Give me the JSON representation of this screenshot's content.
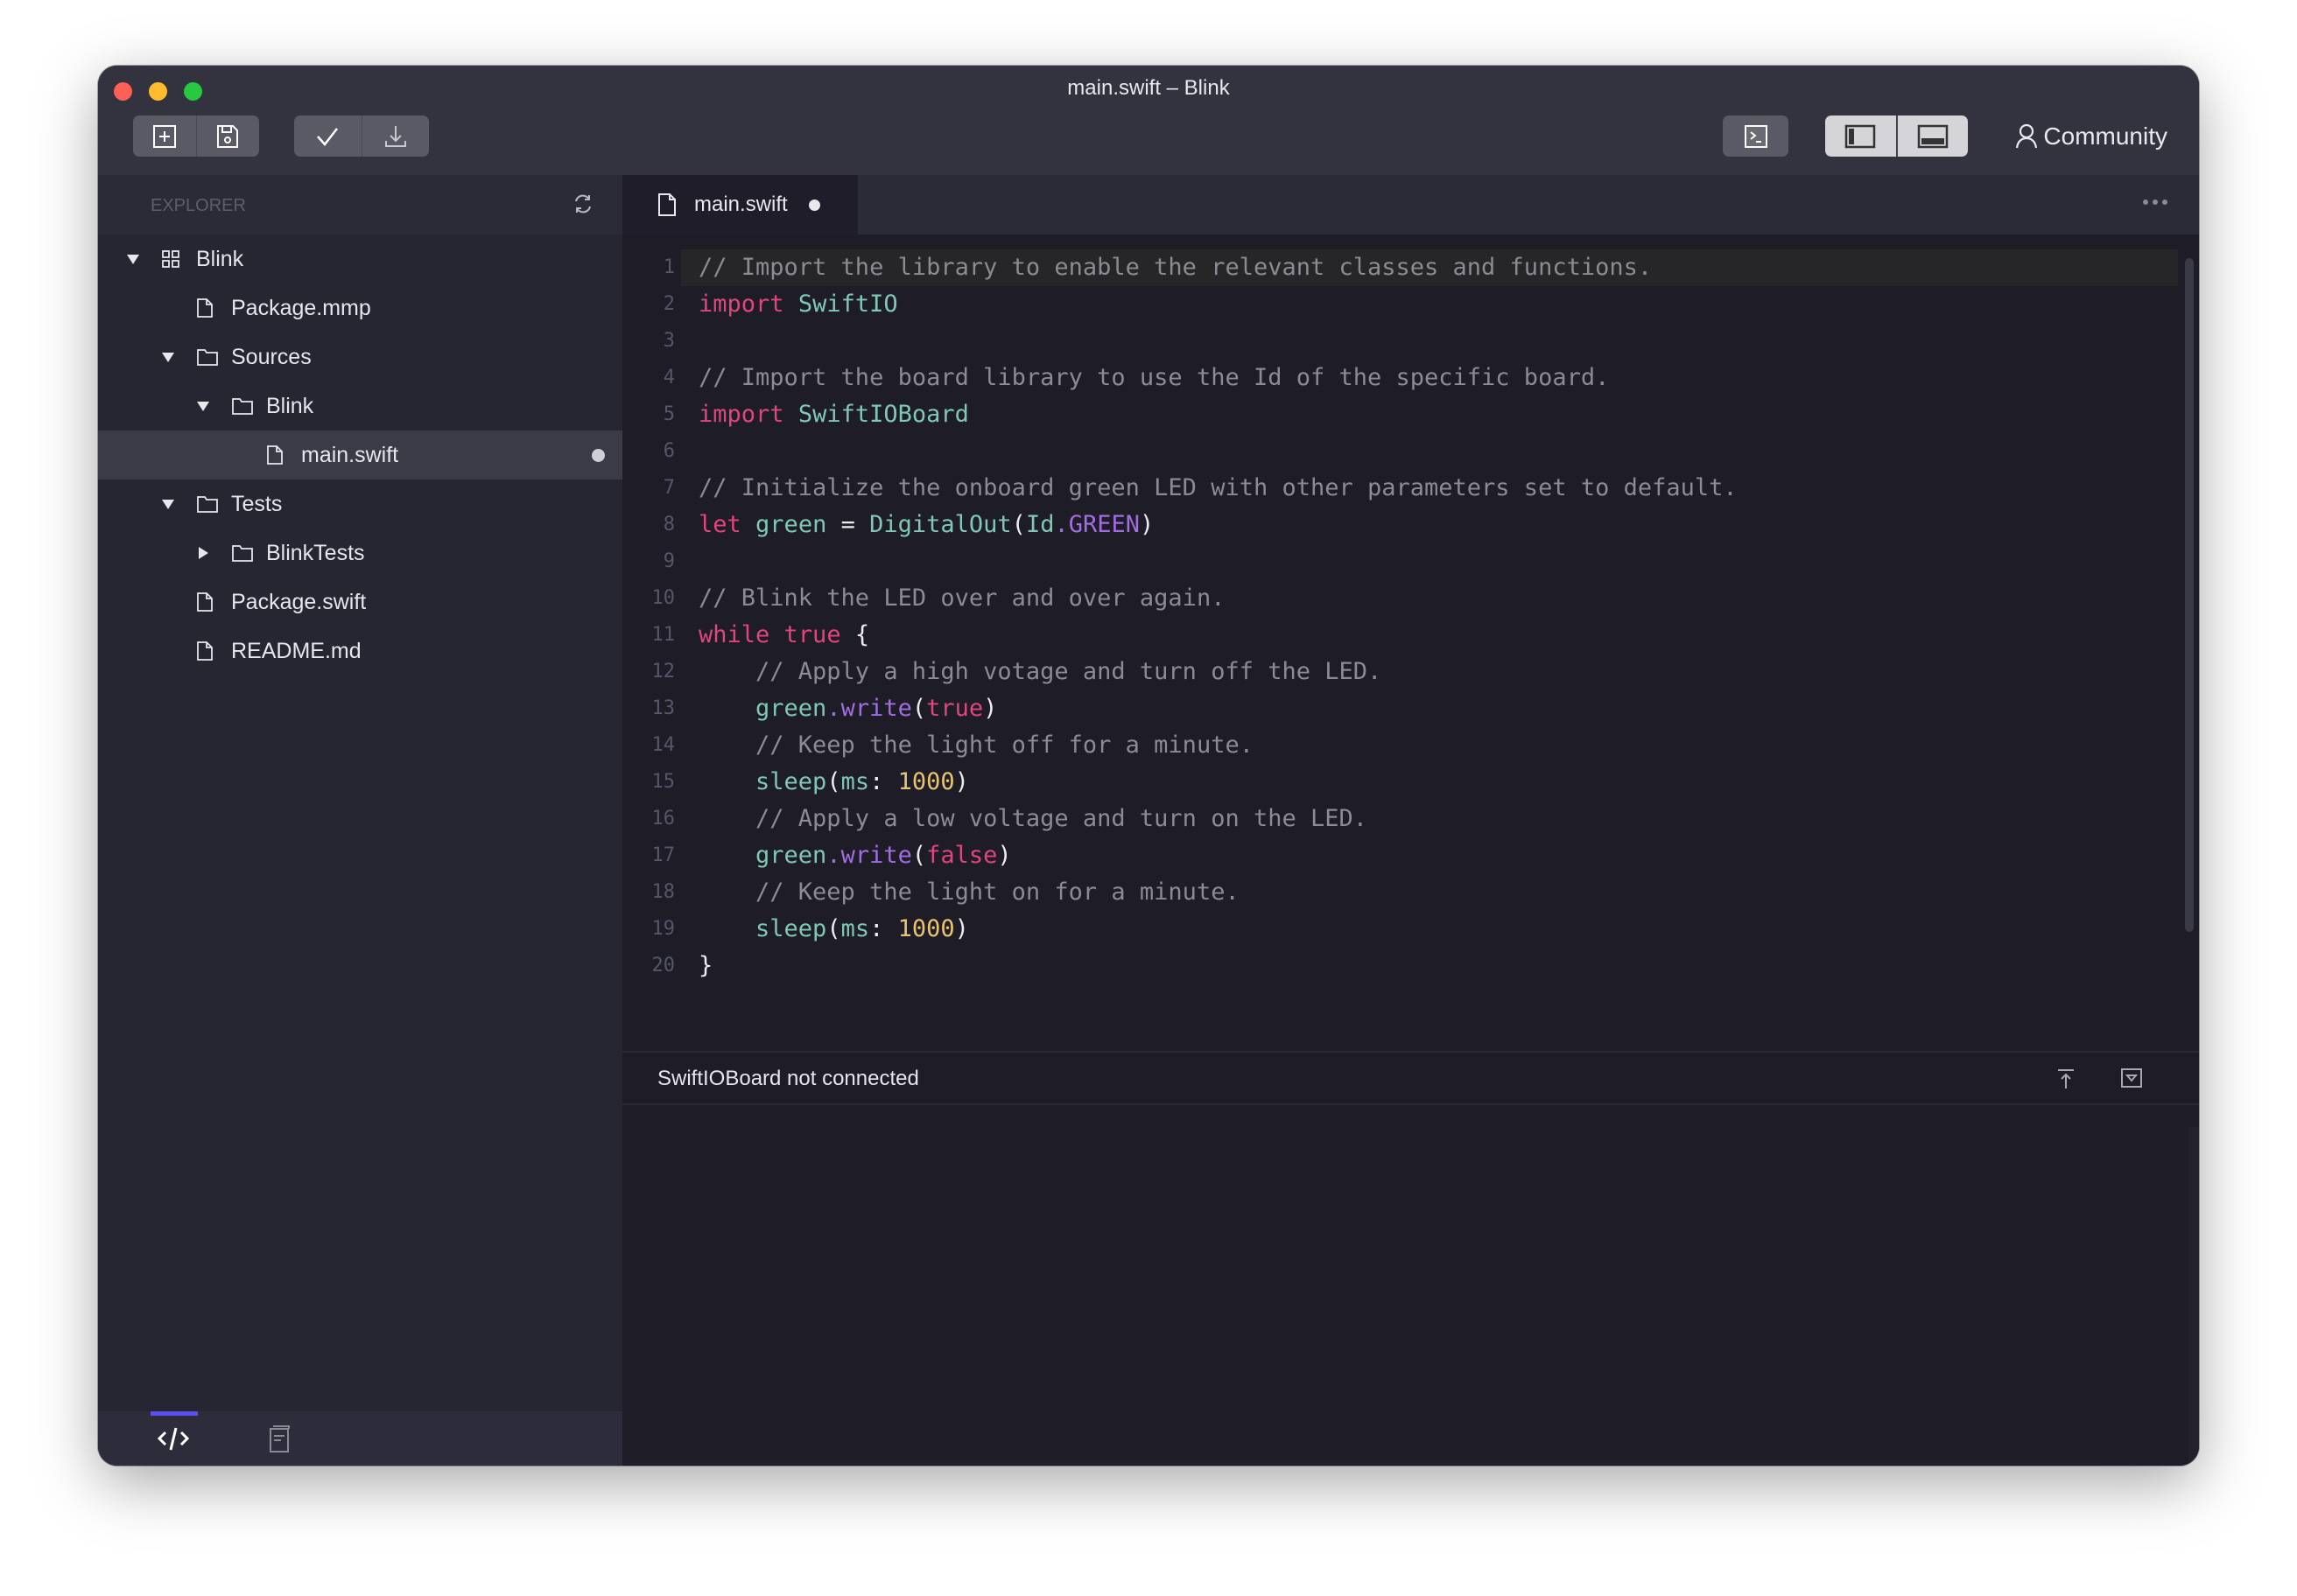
{
  "window": {
    "title": "main.swift – Blink",
    "traffic_lights": {
      "close": "#fe5f57",
      "minimize": "#febc2e",
      "zoom": "#28c840"
    }
  },
  "toolbar": {
    "left_groups": [
      [
        {
          "icon": "new-file-icon"
        },
        {
          "icon": "save-icon"
        }
      ],
      [
        {
          "icon": "check-icon"
        },
        {
          "icon": "download-icon"
        }
      ]
    ],
    "terminal_icon": "terminal-icon",
    "layout_buttons": [
      {
        "icon": "sidebar-layout-icon"
      },
      {
        "icon": "bottom-panel-layout-icon"
      }
    ],
    "community_label": "Community",
    "community_icon": "user-icon"
  },
  "sidebar": {
    "header": "EXPLORER",
    "refresh_icon": "refresh-icon",
    "tree": [
      {
        "label": "Blink",
        "level": 0,
        "type": "project",
        "expanded": true
      },
      {
        "label": "Package.mmp",
        "level": 1,
        "type": "file"
      },
      {
        "label": "Sources",
        "level": 1,
        "type": "folder",
        "expanded": true
      },
      {
        "label": "Blink",
        "level": 2,
        "type": "folder",
        "expanded": true
      },
      {
        "label": "main.swift",
        "level": 3,
        "type": "file",
        "selected": true,
        "modified": true
      },
      {
        "label": "Tests",
        "level": 1,
        "type": "folder",
        "expanded": true
      },
      {
        "label": "BlinkTests",
        "level": 2,
        "type": "folder",
        "expanded": false
      },
      {
        "label": "Package.swift",
        "level": 1,
        "type": "file"
      },
      {
        "label": "README.md",
        "level": 1,
        "type": "file"
      }
    ],
    "footer_tabs": [
      {
        "icon": "code-icon",
        "active": true
      },
      {
        "icon": "book-icon",
        "active": false
      }
    ],
    "accent": "#5b4ff0"
  },
  "editor": {
    "tab": {
      "label": "main.swift",
      "modified": true
    },
    "highlighted_line": 1,
    "lines": [
      [
        [
          "c",
          "// Import the library to enable the relevant classes and functions."
        ]
      ],
      [
        [
          "k",
          "import"
        ],
        [
          "p",
          " "
        ],
        [
          "t",
          "SwiftIO"
        ]
      ],
      [],
      [
        [
          "c",
          "// Import the board library to use the Id of the specific board."
        ]
      ],
      [
        [
          "k",
          "import"
        ],
        [
          "p",
          " "
        ],
        [
          "t",
          "SwiftIOBoard"
        ]
      ],
      [],
      [
        [
          "c",
          "// Initialize the onboard green LED with other parameters set to default."
        ]
      ],
      [
        [
          "k",
          "let"
        ],
        [
          "p",
          " "
        ],
        [
          "t",
          "green"
        ],
        [
          "p",
          " = "
        ],
        [
          "t",
          "DigitalOut"
        ],
        [
          "p",
          "("
        ],
        [
          "t",
          "Id"
        ],
        [
          "m",
          ".GREEN"
        ],
        [
          "p",
          ")"
        ]
      ],
      [],
      [
        [
          "c",
          "// Blink the LED over and over again."
        ]
      ],
      [
        [
          "k",
          "while"
        ],
        [
          "p",
          " "
        ],
        [
          "k",
          "true"
        ],
        [
          "p",
          " {"
        ]
      ],
      [
        [
          "c",
          "    // Apply a high votage and turn off the LED."
        ]
      ],
      [
        [
          "p",
          "    "
        ],
        [
          "t",
          "green"
        ],
        [
          "m",
          ".write"
        ],
        [
          "p",
          "("
        ],
        [
          "k",
          "true"
        ],
        [
          "p",
          ")"
        ]
      ],
      [
        [
          "c",
          "    // Keep the light off for a minute."
        ]
      ],
      [
        [
          "p",
          "    "
        ],
        [
          "t",
          "sleep"
        ],
        [
          "p",
          "("
        ],
        [
          "t",
          "ms"
        ],
        [
          "p",
          ": "
        ],
        [
          "n",
          "1000"
        ],
        [
          "p",
          ")"
        ]
      ],
      [
        [
          "c",
          "    // Apply a low voltage and turn on the LED."
        ]
      ],
      [
        [
          "p",
          "    "
        ],
        [
          "t",
          "green"
        ],
        [
          "m",
          ".write"
        ],
        [
          "p",
          "("
        ],
        [
          "k",
          "false"
        ],
        [
          "p",
          ")"
        ]
      ],
      [
        [
          "c",
          "    // Keep the light on for a minute."
        ]
      ],
      [
        [
          "p",
          "    "
        ],
        [
          "t",
          "sleep"
        ],
        [
          "p",
          "("
        ],
        [
          "t",
          "ms"
        ],
        [
          "p",
          ": "
        ],
        [
          "n",
          "1000"
        ],
        [
          "p",
          ")"
        ]
      ],
      [
        [
          "p",
          "}"
        ]
      ]
    ]
  },
  "status": {
    "text": "SwiftIOBoard not connected",
    "icons": [
      "scroll-to-top-icon",
      "collapse-panel-icon"
    ]
  }
}
